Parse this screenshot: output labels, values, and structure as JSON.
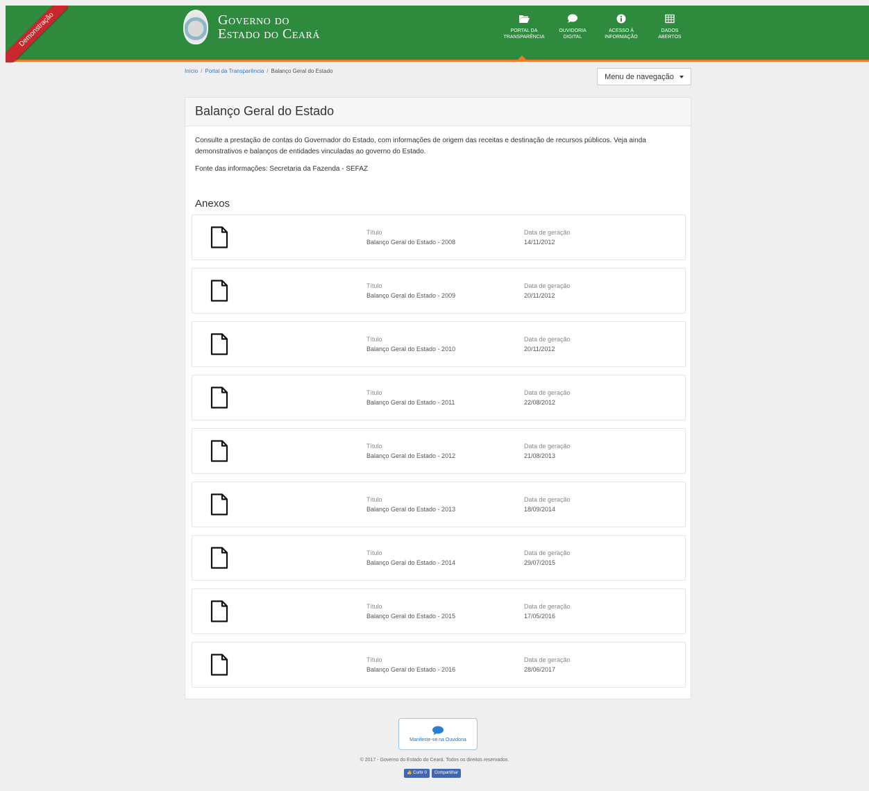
{
  "banner": {
    "label": "Demonstração"
  },
  "brand": {
    "line1": "Governo do",
    "line2": "Estado do Ceará"
  },
  "topnav": [
    {
      "id": "portal",
      "line1": "PORTAL DA",
      "line2": "TRANSPARÊNCIA",
      "icon": "folder-open-icon"
    },
    {
      "id": "ouvidoria",
      "line1": "OUVIDORIA",
      "line2": "DIGITAL",
      "icon": "speech-bubble-icon"
    },
    {
      "id": "acesso",
      "line1": "ACESSO À",
      "line2": "INFORMAÇÃO",
      "icon": "info-icon"
    },
    {
      "id": "dados",
      "line1": "DADOS",
      "line2": "ABERTOS",
      "icon": "table-icon"
    }
  ],
  "breadcrumb": {
    "home": "Início",
    "portal": "Portal da Transparência",
    "current": "Balanço Geral do Estado"
  },
  "nav_menu": {
    "label": "Menu de navegação"
  },
  "panel": {
    "title": "Balanço Geral do Estado",
    "intro": "Consulte a prestação de contas do Governador do Estado, com informações de origem das receitas e destinação de recursos públicos. Veja ainda demonstrativos e balanços de entidades vinculadas ao governo do Estado.",
    "source": "Fonte das informações: Secretaria da Fazenda - SEFAZ",
    "attachments_title": "Anexos"
  },
  "attachments": {
    "title_label": "Título",
    "date_label": "Data de geração",
    "items": [
      {
        "title": "Balanço Geral do Estado - 2008",
        "date": "14/11/2012"
      },
      {
        "title": "Balanço Geral do Estado - 2009",
        "date": "20/11/2012"
      },
      {
        "title": "Balanço Geral do Estado - 2010",
        "date": "20/11/2012"
      },
      {
        "title": "Balanço Geral do Estado - 2011",
        "date": "22/08/2012"
      },
      {
        "title": "Balanço Geral do Estado - 2012",
        "date": "21/08/2013"
      },
      {
        "title": "Balanço Geral do Estado - 2013",
        "date": "18/09/2014"
      },
      {
        "title": "Balanço Geral do Estado - 2014",
        "date": "29/07/2015"
      },
      {
        "title": "Balanço Geral do Estado - 2015",
        "date": "17/05/2016"
      },
      {
        "title": "Balanço Geral do Estado - 2016",
        "date": "28/06/2017"
      }
    ]
  },
  "footer": {
    "ouvidoria_label": "Manifeste-se na Ouvidoria",
    "copyright": "© 2017 - Governo do Estado do Ceará. Todos os direitos reservados.",
    "like_label": "Curtir 0",
    "share_label": "Compartilhar"
  },
  "colors": {
    "header_green": "#2e8b3e",
    "accent_orange": "#f07a28",
    "ribbon_red": "#c8282d",
    "link_blue": "#3578c4"
  }
}
